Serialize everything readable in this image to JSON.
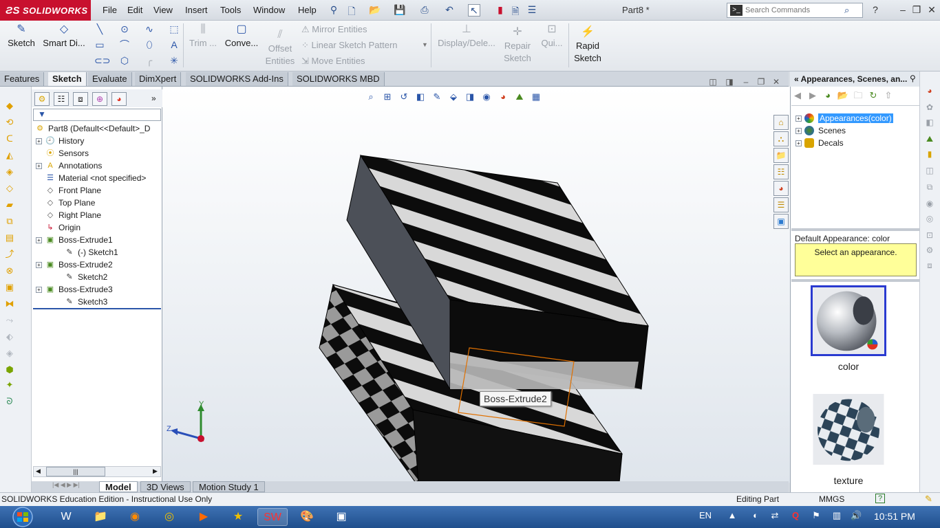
{
  "app": {
    "brand": "SOLIDWORKS",
    "doc_title": "Part8 *"
  },
  "menu": [
    "File",
    "Edit",
    "View",
    "Insert",
    "Tools",
    "Window",
    "Help"
  ],
  "search": {
    "placeholder": "Search Commands"
  },
  "commands": {
    "sketch": "Sketch",
    "smart_dim": "Smart Di...",
    "trim": "Trim ...",
    "convert": "Conve...",
    "offset_1": "Offset",
    "offset_2": "Entities",
    "mirror": "Mirror Entities",
    "linear_pattern": "Linear Sketch Pattern",
    "move": "Move Entities",
    "display_delete": "Display/Dele...",
    "repair_1": "Repair",
    "repair_2": "Sketch",
    "quick": "Qui...",
    "rapid_1": "Rapid",
    "rapid_2": "Sketch"
  },
  "tabs": [
    "Features",
    "Sketch",
    "Evaluate",
    "DimXpert",
    "SOLIDWORKS Add-Ins",
    "SOLIDWORKS MBD"
  ],
  "active_tab": "Sketch",
  "tree": {
    "root": "Part8  (Default<<Default>_D",
    "items": [
      {
        "label": "History",
        "icon": "history-icon",
        "expandable": true,
        "indent": 0
      },
      {
        "label": "Sensors",
        "icon": "sensors-icon",
        "expandable": false,
        "indent": 0
      },
      {
        "label": "Annotations",
        "icon": "annotations-icon",
        "expandable": true,
        "indent": 0
      },
      {
        "label": "Material <not specified>",
        "icon": "material-icon",
        "expandable": false,
        "indent": 0
      },
      {
        "label": "Front Plane",
        "icon": "plane-icon",
        "expandable": false,
        "indent": 0
      },
      {
        "label": "Top Plane",
        "icon": "plane-icon",
        "expandable": false,
        "indent": 0
      },
      {
        "label": "Right Plane",
        "icon": "plane-icon",
        "expandable": false,
        "indent": 0
      },
      {
        "label": "Origin",
        "icon": "origin-icon",
        "expandable": false,
        "indent": 0
      },
      {
        "label": "Boss-Extrude1",
        "icon": "extrude-icon",
        "expandable": true,
        "indent": 0
      },
      {
        "label": "(-) Sketch1",
        "icon": "sketch-icon",
        "expandable": false,
        "indent": 1
      },
      {
        "label": "Boss-Extrude2",
        "icon": "extrude-icon",
        "expandable": true,
        "indent": 0
      },
      {
        "label": "Sketch2",
        "icon": "sketch-icon",
        "expandable": false,
        "indent": 1
      },
      {
        "label": "Boss-Extrude3",
        "icon": "extrude-icon",
        "expandable": true,
        "indent": 0
      },
      {
        "label": "Sketch3",
        "icon": "sketch-icon",
        "expandable": false,
        "indent": 1
      }
    ]
  },
  "viewport": {
    "tooltip": "Boss-Extrude2",
    "triad": {
      "x": "X",
      "y": "Y",
      "z": "Z"
    }
  },
  "taskpane": {
    "header": "Appearances, Scenes, an...",
    "nodes": [
      "Appearances(color)",
      "Scenes",
      "Decals"
    ],
    "default_label": "Default Appearance: color",
    "default_msg": "Select an appearance.",
    "thumb1": "color",
    "thumb2": "texture"
  },
  "bottom_tabs": [
    "Model",
    "3D Views",
    "Motion Study 1"
  ],
  "status": {
    "left": "SOLIDWORKS Education Edition - Instructional Use Only",
    "mode": "Editing Part",
    "units": "MMGS",
    "help": "?"
  },
  "taskbar": {
    "lang": "EN",
    "time": "10:51 PM"
  },
  "colors": {
    "brand_red": "#c8102e",
    "selection_blue": "#3399ff",
    "tooltip_yellow": "#ffff99",
    "taskbar_blue": "#2b5d9f"
  }
}
